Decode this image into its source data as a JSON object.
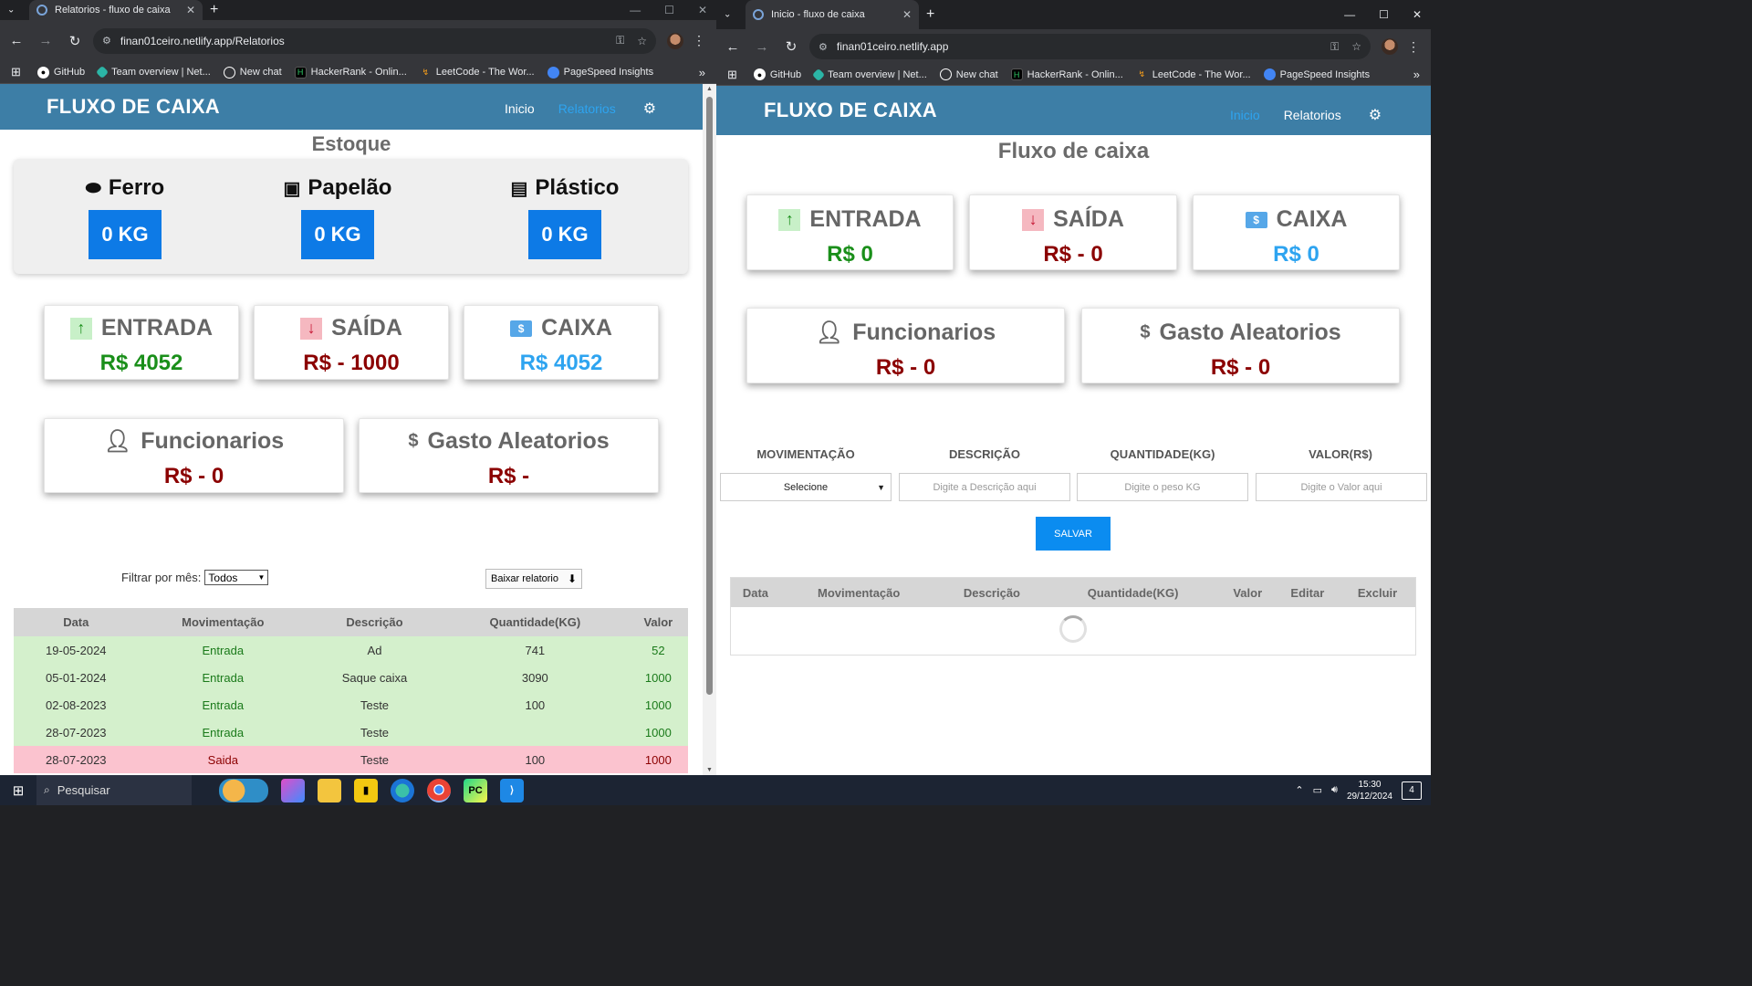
{
  "left_browser": {
    "tab_title": "Relatorios - fluxo de caixa",
    "url": "finan01ceiro.netlify.app/Relatorios"
  },
  "right_browser": {
    "tab_title": "Inicio - fluxo de caixa",
    "url": "finan01ceiro.netlify.app"
  },
  "bookmarks": [
    "GitHub",
    "Team overview | Net...",
    "New chat",
    "HackerRank - Onlin...",
    "LeetCode - The Wor...",
    "PageSpeed Insights"
  ],
  "app": {
    "brand": "FLUXO DE CAIXA",
    "nav_inicio": "Inicio",
    "nav_relatorios": "Relatorios"
  },
  "relatorios": {
    "estoque_title": "Estoque",
    "estoque": [
      {
        "name": "Ferro",
        "value": "0 KG",
        "icon": "ferro-icon"
      },
      {
        "name": "Papelão",
        "value": "0 KG",
        "icon": "box-icon"
      },
      {
        "name": "Plástico",
        "value": "0 KG",
        "icon": "plastic-icon"
      }
    ],
    "entrada": {
      "label": "ENTRADA",
      "value": "R$ 4052"
    },
    "saida": {
      "label": "SAÍDA",
      "value": "R$ - 1000"
    },
    "caixa": {
      "label": "CAIXA",
      "value": "R$ 4052"
    },
    "funcionarios": {
      "label": "Funcionarios",
      "value": "R$ - 0"
    },
    "gasto": {
      "label": "Gasto Aleatorios",
      "value": "R$ -"
    },
    "filter_label": "Filtrar por mês:",
    "filter_value": "Todos",
    "download_label": "Baixar relatorio",
    "table": {
      "headers": [
        "Data",
        "Movimentação",
        "Descrição",
        "Quantidade(KG)",
        "Valor"
      ],
      "rows": [
        {
          "type": "in",
          "cells": [
            "19-05-2024",
            "Entrada",
            "Ad",
            "741",
            "52"
          ]
        },
        {
          "type": "in",
          "cells": [
            "05-01-2024",
            "Entrada",
            "Saque caixa",
            "3090",
            "1000"
          ]
        },
        {
          "type": "in",
          "cells": [
            "02-08-2023",
            "Entrada",
            "Teste",
            "100",
            "1000"
          ]
        },
        {
          "type": "in",
          "cells": [
            "28-07-2023",
            "Entrada",
            "Teste",
            "",
            "1000"
          ]
        },
        {
          "type": "out",
          "cells": [
            "28-07-2023",
            "Saida",
            "Teste",
            "100",
            "1000"
          ]
        }
      ]
    }
  },
  "inicio": {
    "title": "Fluxo de caixa",
    "entrada": {
      "label": "ENTRADA",
      "value": "R$ 0"
    },
    "saida": {
      "label": "SAÍDA",
      "value": "R$ - 0"
    },
    "caixa": {
      "label": "CAIXA",
      "value": "R$ 0"
    },
    "funcionarios": {
      "label": "Funcionarios",
      "value": "R$ - 0"
    },
    "gasto": {
      "label": "Gasto Aleatorios",
      "value": "R$ - 0"
    },
    "form": {
      "labels": [
        "MOVIMENTAÇÃO",
        "DESCRIÇÃO",
        "QUANTIDADE(KG)",
        "VALOR(R$)"
      ],
      "select_value": "Selecione",
      "desc_placeholder": "Digite a Descrição aqui",
      "qty_placeholder": "Digite o peso KG",
      "value_placeholder": "Digite o Valor aqui",
      "save_label": "SALVAR"
    },
    "table_headers": [
      "Data",
      "Movimentação",
      "Descrição",
      "Quantidade(KG)",
      "Valor",
      "Editar",
      "Excluir"
    ]
  },
  "taskbar": {
    "search_label": "Pesquisar",
    "time": "15:30",
    "date": "29/12/2024",
    "notifications": "4"
  }
}
